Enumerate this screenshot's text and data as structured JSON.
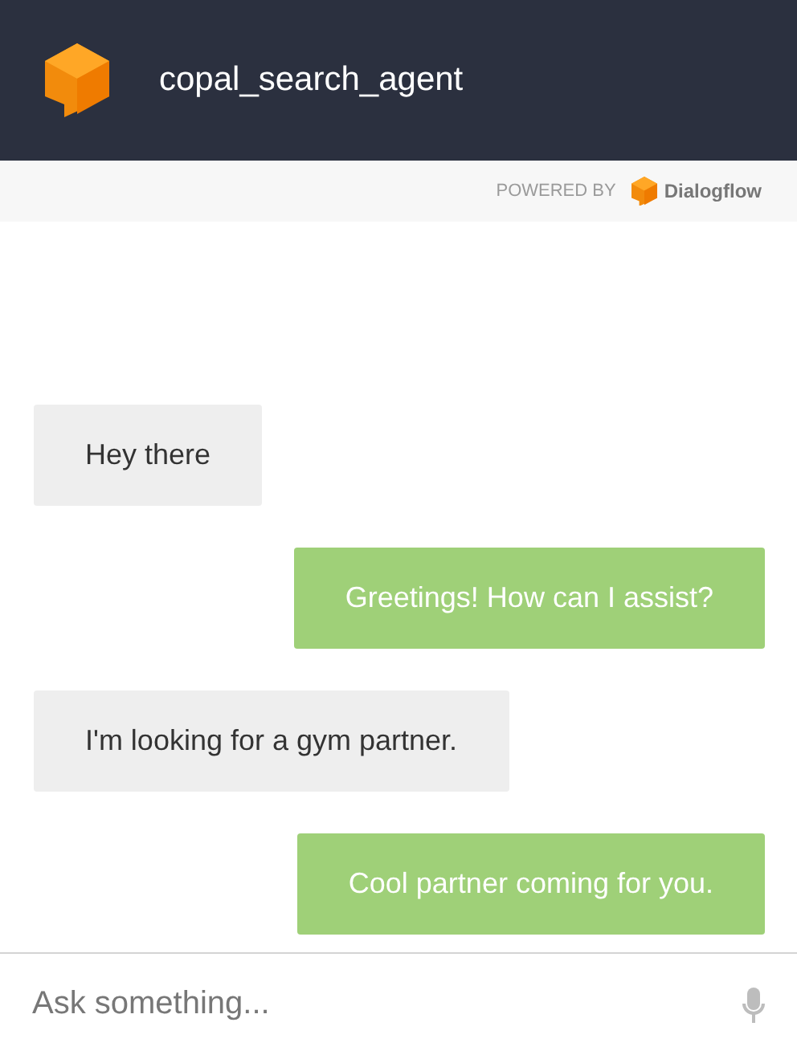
{
  "header": {
    "title": "copal_search_agent"
  },
  "powered_by": {
    "label": "POWERED BY",
    "brand": "Dialogflow"
  },
  "messages": [
    {
      "kind": "user",
      "text": "Hey there"
    },
    {
      "kind": "agent",
      "text": "Greetings! How can I assist?"
    },
    {
      "kind": "user",
      "text": "I'm looking for a gym partner."
    },
    {
      "kind": "agent",
      "text": "Cool partner coming for you."
    }
  ],
  "input": {
    "placeholder": "Ask something..."
  }
}
